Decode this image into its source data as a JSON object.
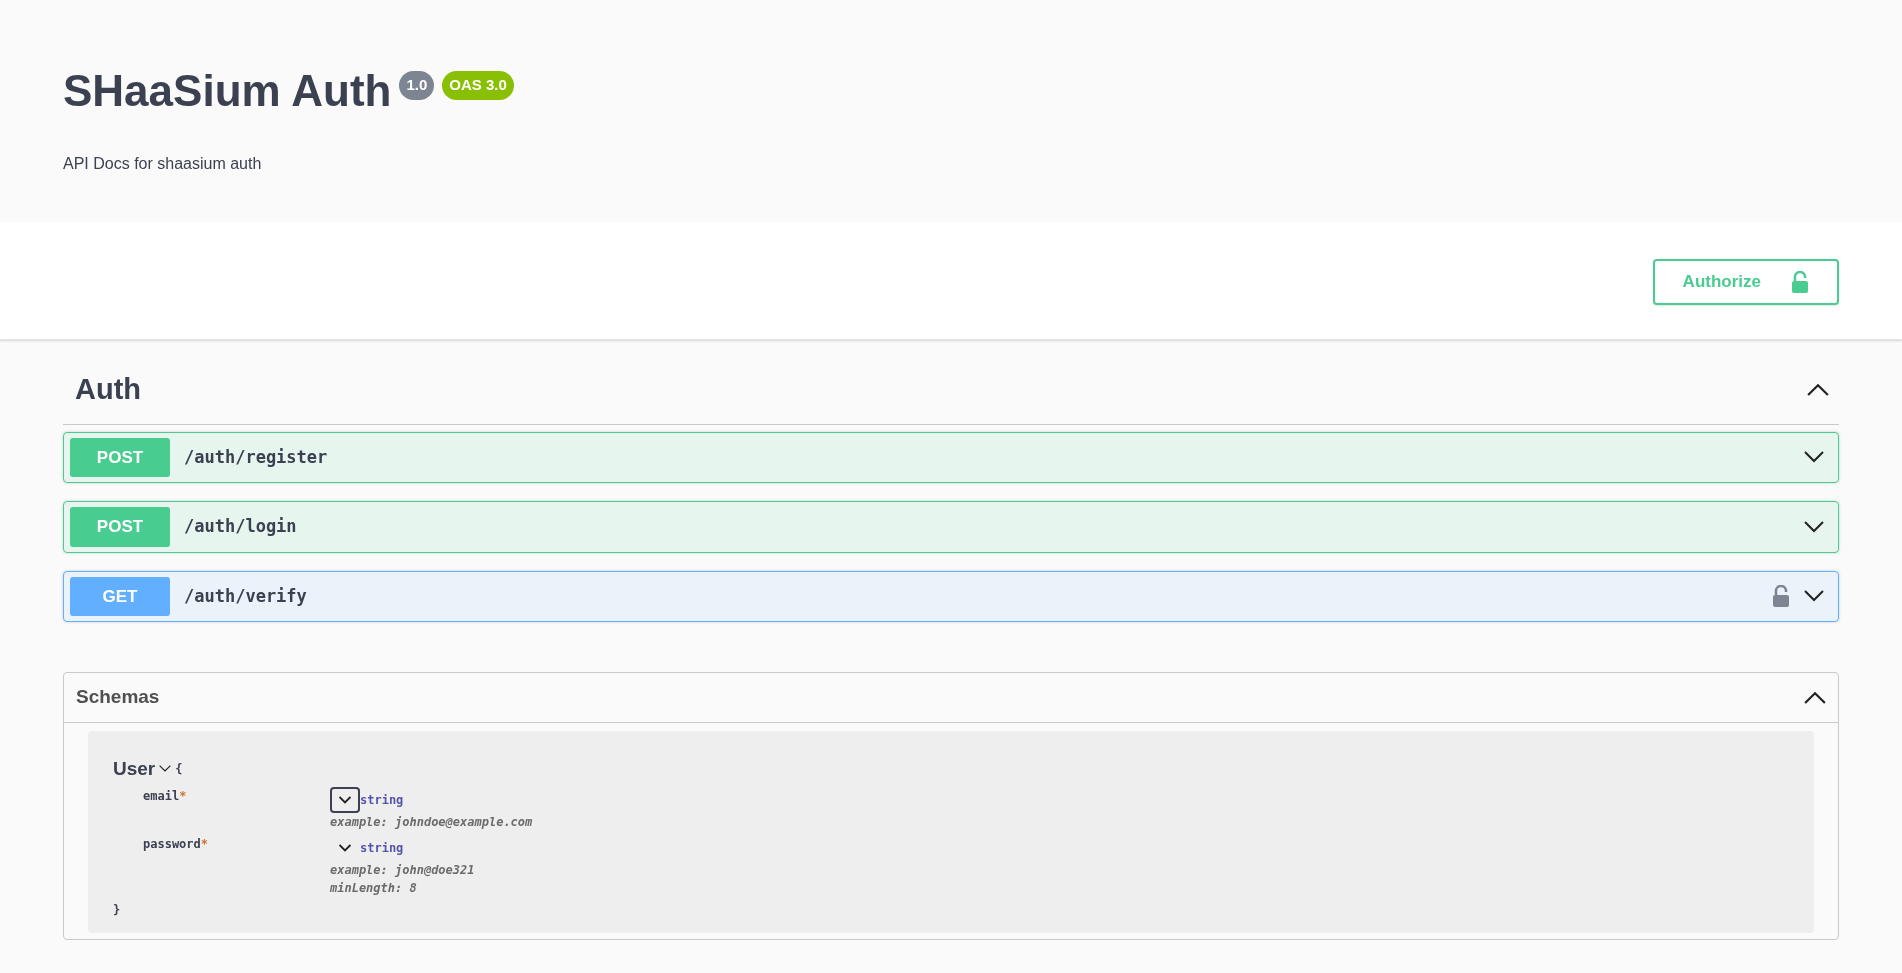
{
  "info": {
    "title": "SHaaSium Auth",
    "badges": [
      {
        "text": "1.0",
        "color": "#7d8492"
      },
      {
        "text": "OAS 3.0",
        "color": "#89bf04"
      }
    ],
    "description": "API Docs for shaasium auth"
  },
  "authorize": {
    "label": "Authorize"
  },
  "tag": {
    "name": "Auth",
    "expanded": true
  },
  "operations": [
    {
      "method": "POST",
      "path": "/auth/register",
      "secured": false,
      "expanded": false
    },
    {
      "method": "POST",
      "path": "/auth/login",
      "secured": false,
      "expanded": false
    },
    {
      "method": "GET",
      "path": "/auth/verify",
      "secured": true,
      "expanded": false
    }
  ],
  "schemas": {
    "title": "Schemas",
    "expanded": true,
    "models": [
      {
        "name": "User",
        "expanded": true,
        "open_brace": "{",
        "close_brace": "}",
        "properties": [
          {
            "name": "email",
            "required_mark": "*",
            "type": "string",
            "focused": true,
            "details": [
              "example: johndoe@example.com"
            ]
          },
          {
            "name": "password",
            "required_mark": "*",
            "type": "string",
            "focused": false,
            "details": [
              "example: john@doe321",
              "minLength: 8"
            ]
          }
        ]
      }
    ]
  }
}
